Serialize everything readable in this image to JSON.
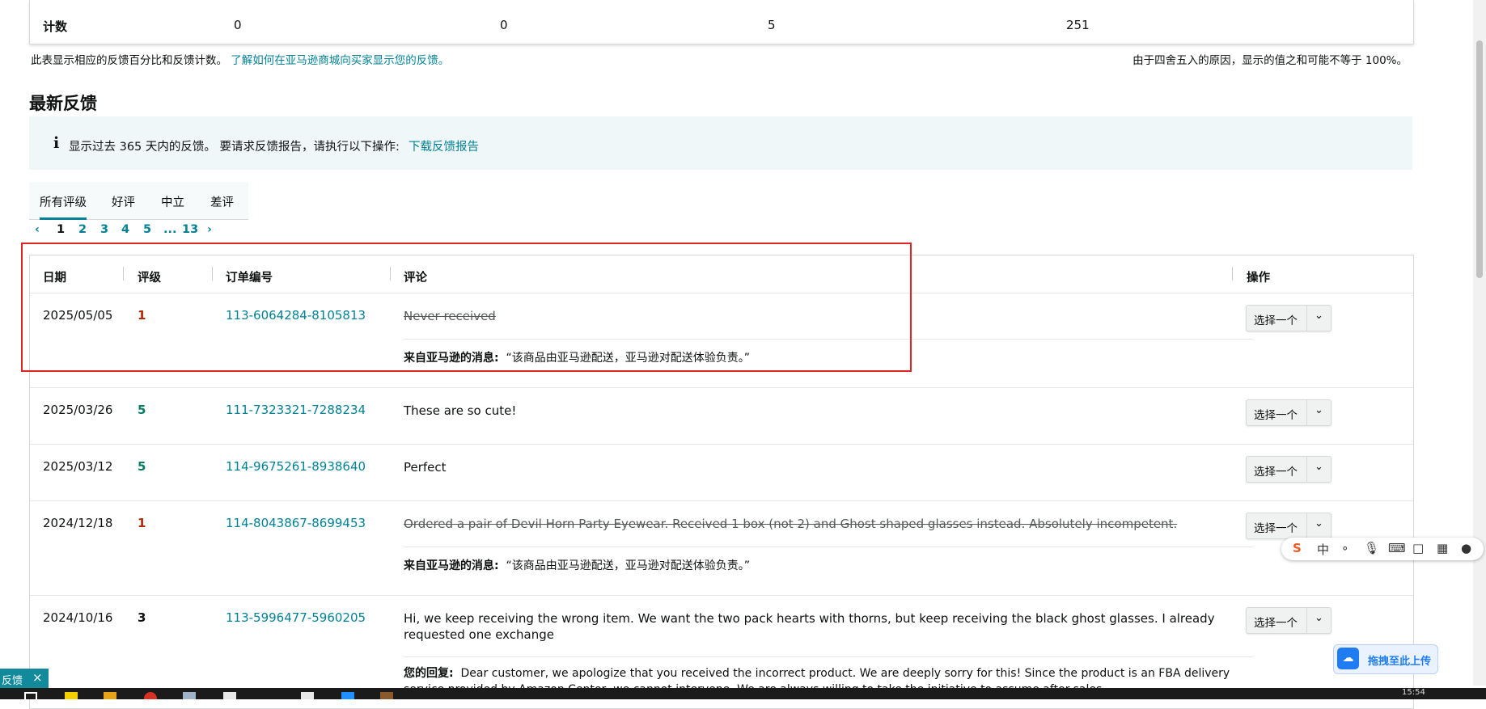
{
  "counts": {
    "label": "计数",
    "v1": "0",
    "v2": "0",
    "v3": "5",
    "v4": "251"
  },
  "notes": {
    "left_text": "此表显示相应的反馈百分比和反馈计数。",
    "left_link": "了解如何在亚马逊商城向买家显示您的反馈。",
    "right_text": "由于四舍五入的原因，显示的值之和可能不等于 100%。"
  },
  "section_title": "最新反馈",
  "info": {
    "icon": "i",
    "text": "显示过去 365 天内的反馈。 要请求反馈报告，请执行以下操作:",
    "link": "下载反馈报告"
  },
  "tabs": [
    "所有评级",
    "好评",
    "中立",
    "差评"
  ],
  "pager": {
    "prev": "‹",
    "pages": [
      "1",
      "2",
      "3",
      "4",
      "5",
      "...",
      "13"
    ],
    "next": "›"
  },
  "table": {
    "headers": {
      "date": "日期",
      "rating": "评级",
      "order": "订单编号",
      "comment": "评论",
      "action": "操作"
    },
    "action_label": "选择一个",
    "amazon_msg_label": "来自亚马逊的消息:",
    "amazon_msg_text": "“该商品由亚马逊配送，亚马逊对配送体验负责。”",
    "reply_label": "您的回复:",
    "rows": [
      {
        "date": "2025/05/05",
        "rating": "1",
        "rating_color": "#b12704",
        "order": "113-6064284-8105813",
        "comment": "Never received"
      },
      {
        "date": "2025/03/26",
        "rating": "5",
        "rating_color": "#067d62",
        "order": "111-7323321-7288234",
        "comment": "These are so cute!"
      },
      {
        "date": "2025/03/12",
        "rating": "5",
        "rating_color": "#067d62",
        "order": "114-9675261-8938640",
        "comment": "Perfect"
      },
      {
        "date": "2024/12/18",
        "rating": "1",
        "rating_color": "#b12704",
        "order": "114-8043867-8699453",
        "comment": "Ordered a pair of Devil Horn Party Eyewear. Received 1 box (not 2) and Ghost shaped glasses instead. Absolutely incompetent."
      },
      {
        "date": "2024/10/16",
        "rating": "3",
        "rating_color": "#0f1111",
        "order": "113-5996477-5960205",
        "comment": "Hi, we keep receiving the wrong item. We want the two pack hearts with thorns, but keep receiving the black ghost glasses. I already requested one exchange",
        "reply": "Dear customer, we apologize that you received the incorrect product. We are deeply sorry for this! Since the product is an FBA delivery service provided by Amazon Center, we cannot intervene. We are always willing to take the initiative to assume after-sales"
      }
    ]
  },
  "ime": {
    "logo": "S",
    "lang": "中"
  },
  "upload": {
    "label": "拖拽至此上传"
  },
  "feedback_chip": {
    "label": "反馈",
    "close": "×"
  },
  "taskbar": {
    "clock": "15:54"
  }
}
